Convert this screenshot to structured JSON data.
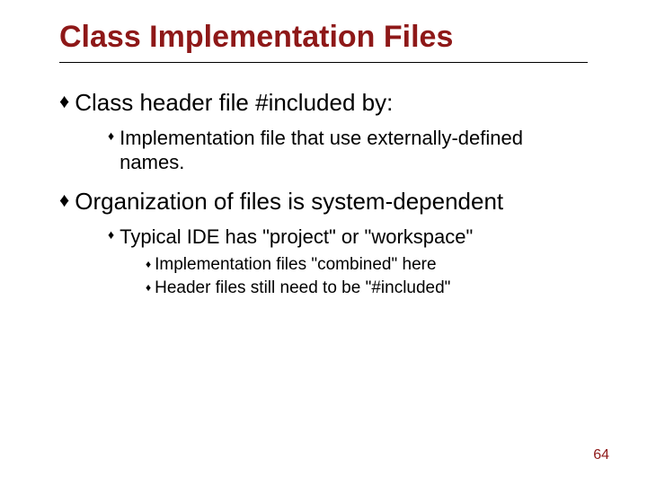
{
  "title": "Class Implementation Files",
  "items": [
    {
      "text": "Class header file #included by:",
      "children": [
        {
          "text": "Implementation file that use externally-defined names.",
          "children": []
        }
      ]
    },
    {
      "text": "Organization of files is system-dependent",
      "children": [
        {
          "text": "Typical IDE has \"project\" or \"workspace\"",
          "children": [
            {
              "text": "Implementation files \"combined\" here"
            },
            {
              "text": "Header files still need to be \"#included\""
            }
          ]
        }
      ]
    }
  ],
  "page_number": "64",
  "bullet_glyph": "♦"
}
